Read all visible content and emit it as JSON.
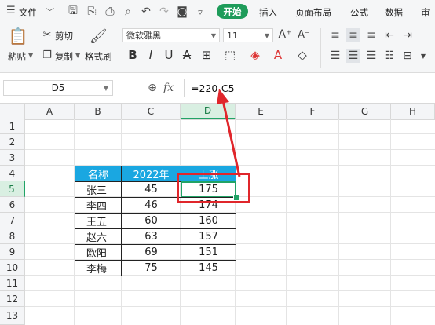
{
  "menubar": {
    "file_label": "文件",
    "tabs": [
      "开始",
      "插入",
      "页面布局",
      "公式",
      "数据",
      "审"
    ]
  },
  "ribbon": {
    "paste_label": "粘贴",
    "cut_label": "剪切",
    "copy_label": "复制",
    "format_painter_label": "格式刷",
    "font_name": "微软雅黑",
    "font_size": "11"
  },
  "formula_bar": {
    "name_box": "D5",
    "fx_label": "fx",
    "formula": "=220-C5"
  },
  "grid": {
    "columns": [
      "A",
      "B",
      "C",
      "D",
      "E",
      "F",
      "G",
      "H"
    ],
    "rows": [
      "1",
      "2",
      "3",
      "4",
      "5",
      "6",
      "7",
      "8",
      "9",
      "10",
      "11",
      "12",
      "13"
    ],
    "active_cell": "D5"
  },
  "table": {
    "headers": [
      "名称",
      "2022年",
      "上涨"
    ],
    "rows": [
      {
        "name": "张三",
        "y2022": "45",
        "rise": "175"
      },
      {
        "name": "李四",
        "y2022": "46",
        "rise": "174"
      },
      {
        "name": "王五",
        "y2022": "60",
        "rise": "160"
      },
      {
        "name": "赵六",
        "y2022": "63",
        "rise": "157"
      },
      {
        "name": "欧阳",
        "y2022": "69",
        "rise": "151"
      },
      {
        "name": "李梅",
        "y2022": "75",
        "rise": "145"
      }
    ]
  },
  "colors": {
    "accent_green": "#1e9c5a",
    "table_header_bg": "#1aa7e1",
    "annotation_red": "#e0262b",
    "selection_green": "#21a366"
  }
}
